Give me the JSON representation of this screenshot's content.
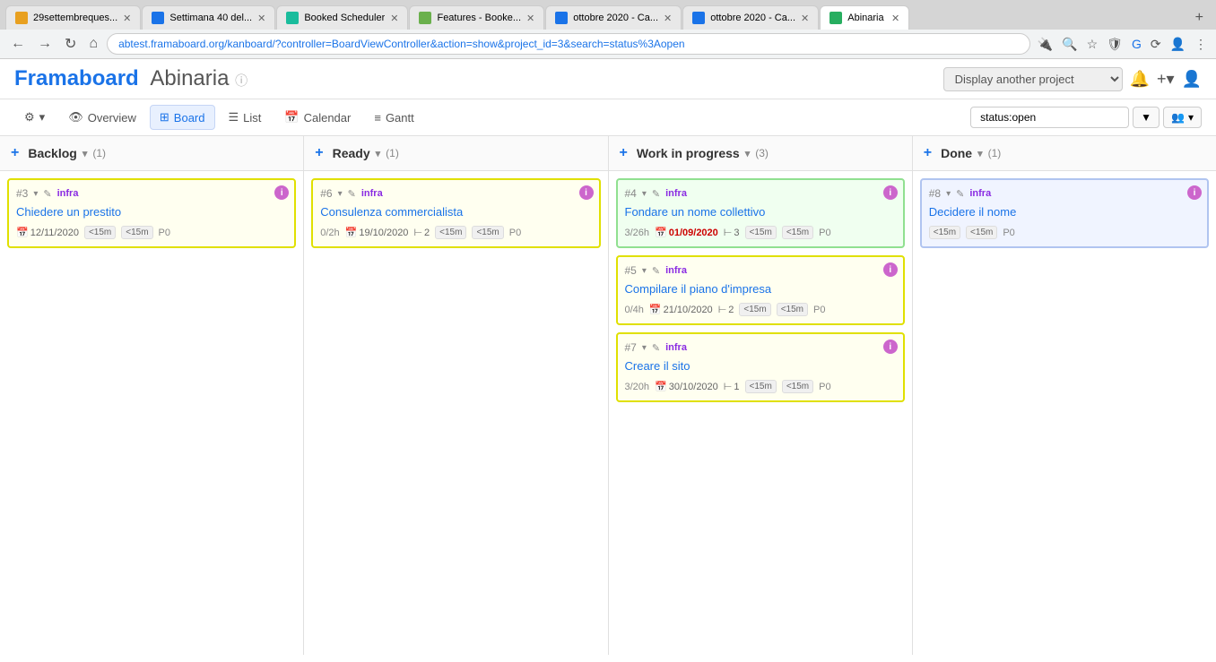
{
  "browser": {
    "tabs": [
      {
        "id": "tab1",
        "label": "29settembreques...",
        "favicon_color": "#e8a020",
        "active": false
      },
      {
        "id": "tab2",
        "label": "Settimana 40 del...",
        "favicon_color": "#1a73e8",
        "active": false
      },
      {
        "id": "tab3",
        "label": "Booked Scheduler",
        "favicon_color": "#1abc9c",
        "active": false
      },
      {
        "id": "tab4",
        "label": "Features - Booke...",
        "favicon_color": "#6ab04c",
        "active": false
      },
      {
        "id": "tab5",
        "label": "ottobre 2020 - Ca...",
        "favicon_color": "#1a73e8",
        "active": false
      },
      {
        "id": "tab6",
        "label": "ottobre 2020 - Ca...",
        "favicon_color": "#1a73e8",
        "active": false
      },
      {
        "id": "tab7",
        "label": "Abinaria",
        "favicon_color": "#27ae60",
        "active": true
      }
    ],
    "url": "abtest.framaboard.org/kanboard/?controller=BoardViewController&action=show&project_id=3&search=status%3Aopen"
  },
  "app": {
    "title_main": "Framaboard",
    "title_sub": "Abinaria",
    "project_placeholder": "Display another project",
    "nav": {
      "overview_label": "Overview",
      "board_label": "Board",
      "list_label": "List",
      "calendar_label": "Calendar",
      "gantt_label": "Gantt",
      "search_value": "status:open"
    }
  },
  "board": {
    "columns": [
      {
        "id": "backlog",
        "title": "Backlog",
        "count": "(1)",
        "cards": [
          {
            "id": "#3",
            "tag": "infra",
            "title": "Chiedere un prestito",
            "date": "12/11/2020",
            "date_overdue": false,
            "time": "",
            "subtasks": "",
            "time_badge1": "<15m",
            "time_badge2": "<15m",
            "priority": "P0",
            "color": "yellow"
          }
        ]
      },
      {
        "id": "ready",
        "title": "Ready",
        "count": "(1)",
        "cards": [
          {
            "id": "#6",
            "tag": "infra",
            "title": "Consulenza commercialista",
            "date": "19/10/2020",
            "date_overdue": false,
            "time": "0/2h",
            "subtasks": "2",
            "time_badge1": "<15m",
            "time_badge2": "<15m",
            "priority": "P0",
            "color": "yellow"
          }
        ]
      },
      {
        "id": "wip",
        "title": "Work in progress",
        "count": "(3)",
        "cards": [
          {
            "id": "#4",
            "tag": "infra",
            "title": "Fondare un nome collettivo",
            "date": "01/09/2020",
            "date_overdue": true,
            "time": "3/26h",
            "subtasks": "3",
            "time_badge1": "<15m",
            "time_badge2": "<15m",
            "priority": "P0",
            "color": "green"
          },
          {
            "id": "#5",
            "tag": "infra",
            "title": "Compilare il piano d'impresa",
            "date": "21/10/2020",
            "date_overdue": false,
            "time": "0/4h",
            "subtasks": "2",
            "time_badge1": "<15m",
            "time_badge2": "<15m",
            "priority": "P0",
            "color": "yellow"
          },
          {
            "id": "#7",
            "tag": "infra",
            "title": "Creare il sito",
            "date": "30/10/2020",
            "date_overdue": false,
            "time": "3/20h",
            "subtasks": "1",
            "time_badge1": "<15m",
            "time_badge2": "<15m",
            "priority": "P0",
            "color": "yellow"
          }
        ]
      },
      {
        "id": "done",
        "title": "Done",
        "count": "(1)",
        "cards": [
          {
            "id": "#8",
            "tag": "infra",
            "title": "Decidere il nome",
            "date": "",
            "date_overdue": false,
            "time": "",
            "subtasks": "",
            "time_badge1": "<15m",
            "time_badge2": "<15m",
            "priority": "P0",
            "color": "blue"
          }
        ]
      }
    ]
  },
  "icons": {
    "settings": "⚙",
    "eye": "👁",
    "grid": "⊞",
    "list": "☰",
    "calendar": "📅",
    "gantt": "≡",
    "filter": "▼",
    "people": "👥",
    "plus": "+",
    "bell": "🔔",
    "add_plus": "+",
    "user": "👤",
    "arrow_down": "▾",
    "pencil": "✎",
    "info": "i",
    "calendar_icon": "📅",
    "subtask_icon": "⊢",
    "clock_icon": "⏱"
  }
}
